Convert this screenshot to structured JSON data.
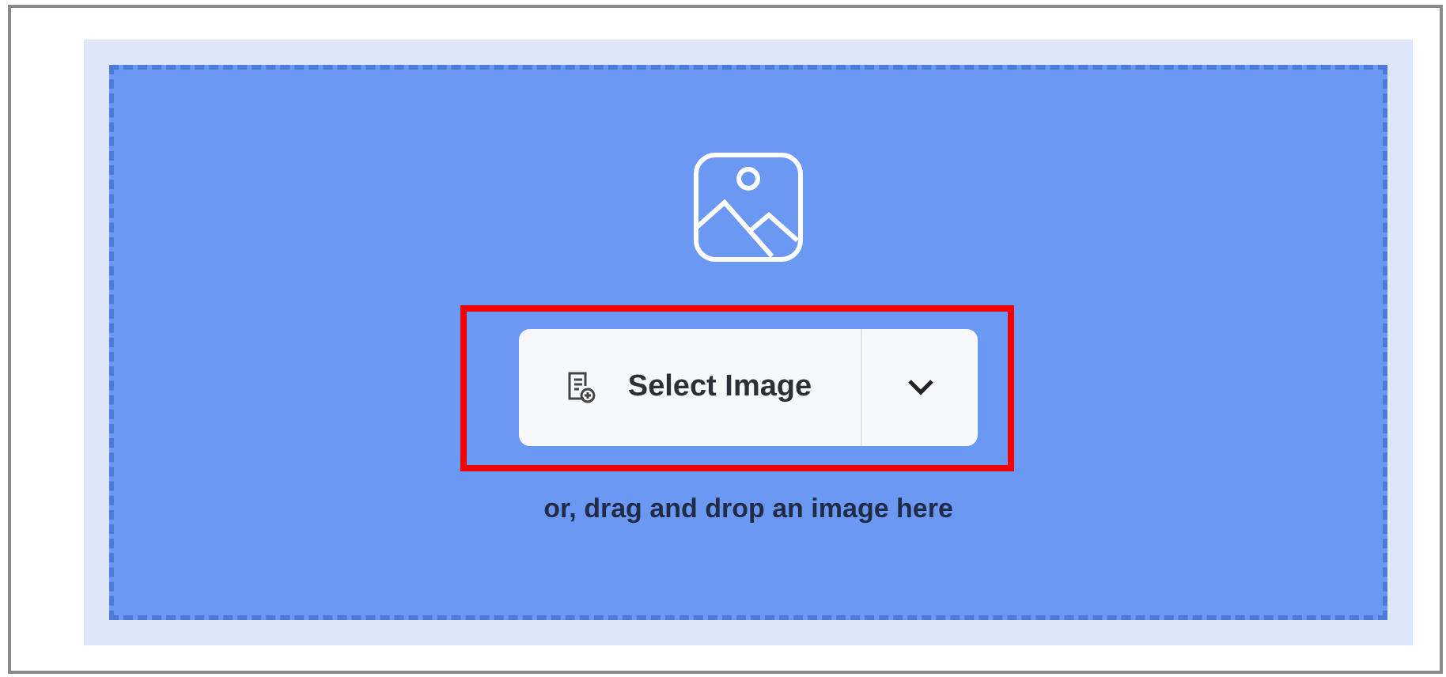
{
  "upload": {
    "button_label": "Select Image",
    "hint": "or, drag and drop an image here",
    "highlighted": true
  }
}
